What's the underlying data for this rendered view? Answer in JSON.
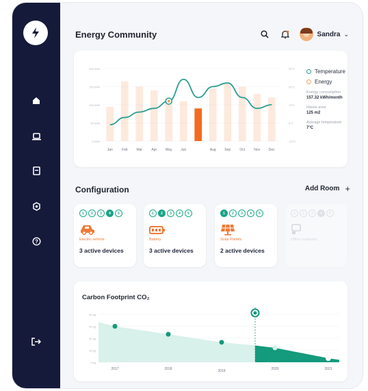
{
  "header": {
    "title": "Energy Community",
    "user_name": "Sandra"
  },
  "sidebar": {
    "items": [
      {
        "icon": "home-icon"
      },
      {
        "icon": "laptop-icon"
      },
      {
        "icon": "tablet-icon"
      },
      {
        "icon": "settings-icon"
      },
      {
        "icon": "help-icon"
      }
    ],
    "logout_icon": "logout-icon"
  },
  "energy_chart": {
    "legend_temperature": "Temperature",
    "legend_energy": "Energy",
    "stats": [
      {
        "label": "Energy consumption",
        "value": "157.32 kWh/month"
      },
      {
        "label": "House area",
        "value": "125 m2"
      },
      {
        "label": "Average temperature",
        "value": "7°C"
      }
    ],
    "colors": {
      "temperature": "#2a9d8f",
      "energy": "#f4a06b",
      "energy_highlight": "#f26b21"
    }
  },
  "configuration": {
    "title": "Configuration",
    "add_room": "Add Room",
    "devices": [
      {
        "name": "Electric vehicle",
        "count": "3 active devices",
        "dots": [
          "1",
          "2",
          "3",
          "4",
          "5"
        ],
        "active_dot": 3,
        "icon": "car-icon"
      },
      {
        "name": "Battery",
        "count": "3 active devices",
        "dots": [
          "1",
          "2",
          "3",
          "4",
          "5"
        ],
        "active_dot": 1,
        "icon": "battery-icon"
      },
      {
        "name": "Solar Panels",
        "count": "2 active devices",
        "dots": [
          "1",
          "2",
          "3",
          "4",
          "5"
        ],
        "active_dot": 0,
        "icon": "solar-panel-icon"
      },
      {
        "name": "Office computer",
        "count": "",
        "dots": [
          "1",
          "2",
          "3",
          "4",
          "5"
        ],
        "active_dot": 3,
        "icon": "computer-icon",
        "faded": true
      }
    ]
  },
  "carbon": {
    "title": "Carbon Footprint CO₂"
  },
  "chart_data": [
    {
      "type": "bar",
      "title": "",
      "categories": [
        "Jan",
        "Feb",
        "Mar",
        "Apr",
        "May",
        "Jun",
        "Jul",
        "Aug",
        "Sep",
        "Oct",
        "Nov",
        "Dec"
      ],
      "highlight_category": "Jul",
      "series": [
        {
          "name": "Energy",
          "values": [
            95,
            165,
            150,
            140,
            120,
            110,
            90,
            145,
            160,
            150,
            130,
            120
          ]
        },
        {
          "name": "Temperature",
          "values": [
            -1,
            3,
            6,
            8,
            12,
            24,
            14,
            20,
            22,
            14,
            8,
            10
          ]
        }
      ],
      "ylim": [
        0,
        200
      ],
      "y2lim": [
        -10,
        30
      ],
      "y_ticks": [
        "0 kWh",
        "50 kWh",
        "100 kWh",
        "150 kWh",
        "200 kWh"
      ],
      "y2_ticks": [
        "-10°C",
        "0°C",
        "10°C",
        "20°C",
        "30°C"
      ]
    },
    {
      "type": "area",
      "x": [
        "2017",
        "2018",
        "2019",
        "2020",
        "2021"
      ],
      "values": [
        45,
        35,
        25,
        18,
        5
      ],
      "ylim": [
        0,
        60
      ],
      "y_ticks": [
        "0 kg",
        "15 kg",
        "30 kg",
        "45 kg",
        "60 kg"
      ]
    }
  ]
}
